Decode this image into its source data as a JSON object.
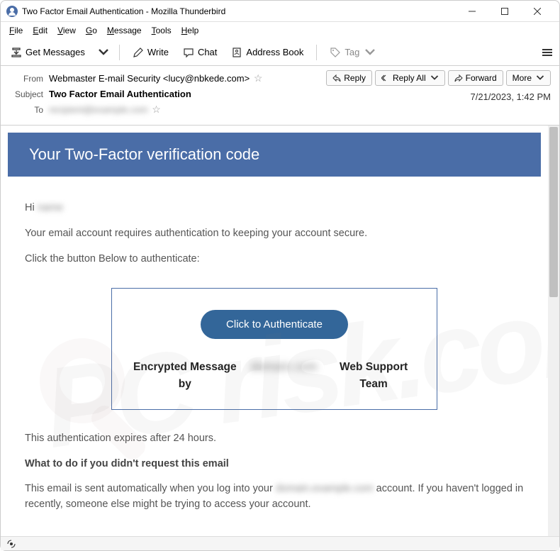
{
  "window": {
    "title": "Two Factor Email Authentication - Mozilla Thunderbird"
  },
  "menu": {
    "items": [
      "File",
      "Edit",
      "View",
      "Go",
      "Message",
      "Tools",
      "Help"
    ]
  },
  "toolbar": {
    "get_messages": "Get Messages",
    "write": "Write",
    "chat": "Chat",
    "address_book": "Address Book",
    "tag": "Tag"
  },
  "header": {
    "from_label": "From",
    "from_value": "Webmaster E-mail Security <lucy@nbkede.com>",
    "subject_label": "Subject",
    "subject_value": "Two Factor Email Authentication",
    "to_label": "To",
    "to_value": "recipient@example.com",
    "datetime": "7/21/2023, 1:42 PM",
    "reply": "Reply",
    "reply_all": "Reply All",
    "forward": "Forward",
    "more": "More"
  },
  "email": {
    "banner": "Your Two-Factor verification code",
    "greeting_prefix": "Hi",
    "greeting_name": "name",
    "line1": "Your email account requires authentication to keeping your account secure.",
    "line2": "Click the button Below to authenticate:",
    "button": "Click to Authenticate",
    "encrypted_prefix": "Encrypted Message by",
    "encrypted_domain": "domain.com",
    "encrypted_suffix": "Web Support Team",
    "expires": "This authentication expires after 24 hours.",
    "not_requested_heading": "What to do if you didn't request this email",
    "not_requested_prefix": "This email is sent automatically when you log into your",
    "not_requested_domain": "domain.example.com",
    "not_requested_suffix": "account. If you haven't logged in recently, someone else might be trying to access your account."
  }
}
